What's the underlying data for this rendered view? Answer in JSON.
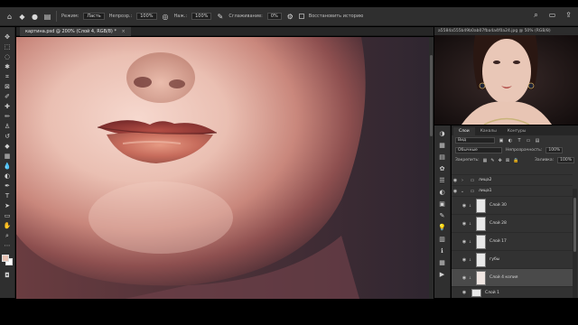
{
  "options_bar": {
    "mode_label": "Режим:",
    "mode_value": "Ласть",
    "opacity_label": "Непрозр.:",
    "opacity_value": "100%",
    "flow_label": "Наж.:",
    "flow_value": "100%",
    "smoothing_label": "Сглаживание:",
    "smoothing_value": "0%",
    "restore_label": "Восстановить историю"
  },
  "document_tab": {
    "title": "картина.psd @ 200% (Слой 4, RGB/8) *",
    "close": "×"
  },
  "navigator": {
    "title": "a5584a555b49b0ab07fba4a4f0a24.jpg @ 50% (RGB/8)"
  },
  "layers_panel": {
    "tabs": [
      "Слои",
      "Каналы",
      "Контуры"
    ],
    "search_value": "Вид",
    "blend_value": "Обычные",
    "opacity_label": "Непрозрачность:",
    "opacity_value": "100%",
    "lock_label": "Закрепить:",
    "fill_label": "Заливка:",
    "fill_value": "100%",
    "layers": [
      {
        "name": "лица2",
        "type": "group"
      },
      {
        "name": "лица1",
        "type": "group"
      },
      {
        "name": "Слой 30",
        "type": "layer"
      },
      {
        "name": "Слой 28",
        "type": "layer"
      },
      {
        "name": "Слой 17",
        "type": "layer"
      },
      {
        "name": "губы",
        "type": "layer"
      },
      {
        "name": "Слой 4 копия",
        "type": "layer"
      },
      {
        "name": "Слой 1",
        "type": "layer"
      }
    ]
  },
  "colors": {
    "foreground": "#e7c1b2",
    "background": "#ffffff"
  }
}
